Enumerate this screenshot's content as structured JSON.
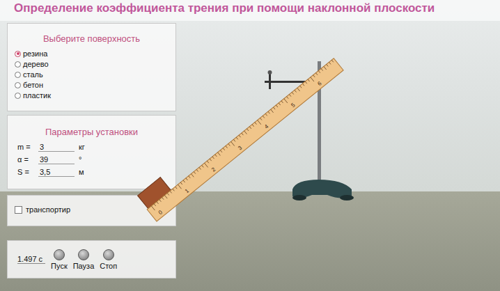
{
  "window": {
    "title": "Определение коэффициента трения при помощи наклонной плоскости"
  },
  "surface_panel": {
    "title": "Выберите поверхность",
    "options": [
      {
        "label": "резина",
        "selected": true
      },
      {
        "label": "дерево",
        "selected": false
      },
      {
        "label": "сталь",
        "selected": false
      },
      {
        "label": "бетон",
        "selected": false
      },
      {
        "label": "пластик",
        "selected": false
      }
    ]
  },
  "params_panel": {
    "title": "Параметры установки",
    "params": [
      {
        "name": "m =",
        "value": "3",
        "unit": "кг"
      },
      {
        "name": "α =",
        "value": "39",
        "unit": "°"
      },
      {
        "name": "S =",
        "value": "3,5",
        "unit": "м"
      }
    ]
  },
  "protractor": {
    "label": "транспортир",
    "checked": false
  },
  "controls": {
    "time": "1.497 с",
    "buttons": [
      {
        "label": "Пуск"
      },
      {
        "label": "Пауза"
      },
      {
        "label": "Стоп"
      }
    ]
  },
  "ruler": {
    "labels": [
      "0",
      "1",
      "2",
      "3",
      "4",
      "5",
      "6"
    ]
  }
}
